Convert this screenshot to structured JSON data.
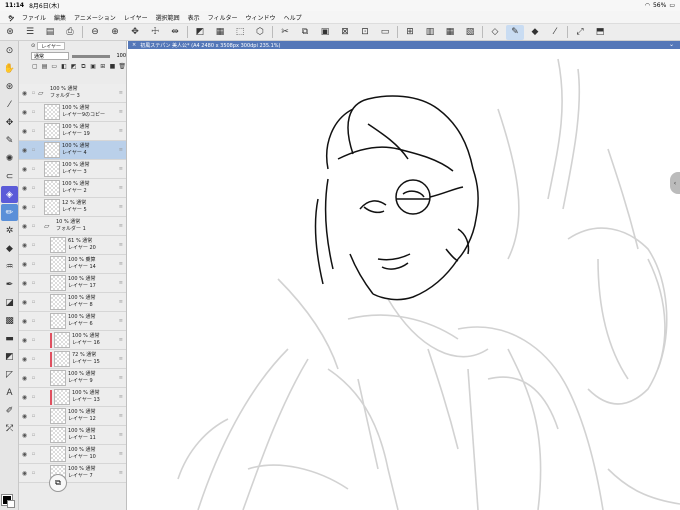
{
  "status": {
    "time": "11:14",
    "date": "8月6日(木)",
    "battery": "56%"
  },
  "menu": [
    "ファイル",
    "編集",
    "アニメーション",
    "レイヤー",
    "選択範囲",
    "表示",
    "フィルター",
    "ウィンドウ",
    "ヘルプ"
  ],
  "panel": {
    "tab_label": "レイヤー",
    "blend_mode": "通常",
    "opacity": "100"
  },
  "document_tab": "初風ステパン 美人公* (A4 2480 x 3508px 300dpi 235.1%)",
  "layers": [
    {
      "type": "folder",
      "top": "100 % 通常",
      "name": "フォルダー 3",
      "indent": 0
    },
    {
      "type": "layer",
      "top": "100 % 通常",
      "name": "レイヤー9のコピー",
      "indent": 1
    },
    {
      "type": "layer",
      "top": "100 % 通常",
      "name": "レイヤー 19",
      "indent": 1
    },
    {
      "type": "layer",
      "top": "100 % 通常",
      "name": "レイヤー 4",
      "indent": 1,
      "selected": true
    },
    {
      "type": "layer",
      "top": "100 % 通常",
      "name": "レイヤー 3",
      "indent": 1
    },
    {
      "type": "layer",
      "top": "100 % 通常",
      "name": "レイヤー 2",
      "indent": 1
    },
    {
      "type": "layer",
      "top": "12 % 通常",
      "name": "レイヤー 5",
      "indent": 1
    },
    {
      "type": "folder",
      "top": "10 % 通常",
      "name": "フォルダー 1",
      "indent": 1
    },
    {
      "type": "layer",
      "top": "61 % 通常",
      "name": "レイヤー 20",
      "indent": 2
    },
    {
      "type": "layer",
      "top": "100 % 乗算",
      "name": "レイヤー 14",
      "indent": 2
    },
    {
      "type": "layer",
      "top": "100 % 通常",
      "name": "レイヤー 17",
      "indent": 2
    },
    {
      "type": "layer",
      "top": "100 % 通常",
      "name": "レイヤー 8",
      "indent": 2
    },
    {
      "type": "layer",
      "top": "100 % 通常",
      "name": "レイヤー 6",
      "indent": 2
    },
    {
      "type": "layer",
      "top": "100 % 通常",
      "name": "レイヤー 16",
      "indent": 2,
      "red": true
    },
    {
      "type": "layer",
      "top": "72 % 通常",
      "name": "レイヤー 15",
      "indent": 2,
      "red": true
    },
    {
      "type": "layer",
      "top": "100 % 通常",
      "name": "レイヤー 9",
      "indent": 2
    },
    {
      "type": "layer",
      "top": "100 % 通常",
      "name": "レイヤー 13",
      "indent": 2,
      "red": true
    },
    {
      "type": "layer",
      "top": "100 % 通常",
      "name": "レイヤー 12",
      "indent": 2
    },
    {
      "type": "layer",
      "top": "100 % 通常",
      "name": "レイヤー 11",
      "indent": 2
    },
    {
      "type": "layer",
      "top": "100 % 通常",
      "name": "レイヤー 10",
      "indent": 2
    },
    {
      "type": "layer",
      "top": "100 % 通常",
      "name": "レイヤー 7",
      "indent": 2
    }
  ],
  "colors": {
    "accent": "#5477b8",
    "selected_row": "#bad0ea",
    "main_color": "#000000",
    "sub_color": "#ffffff"
  }
}
